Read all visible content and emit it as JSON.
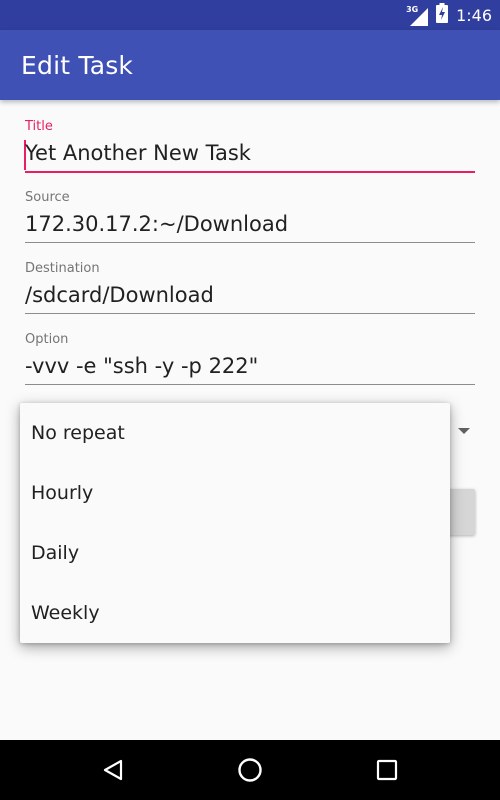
{
  "status_bar": {
    "network_label": "3G",
    "time": "1:46",
    "icons": [
      "signal-icon",
      "battery-charging-icon"
    ]
  },
  "app_bar": {
    "title": "Edit Task"
  },
  "form": {
    "title": {
      "label": "Title",
      "value": "Yet Another New Task"
    },
    "source": {
      "label": "Source",
      "value": "172.30.17.2:~/Download"
    },
    "destination": {
      "label": "Destination",
      "value": "/sdcard/Download"
    },
    "option": {
      "label": "Option",
      "value": "-vvv -e \"ssh -y -p 222\""
    }
  },
  "repeat_dropdown": {
    "options": [
      "No repeat",
      "Hourly",
      "Daily",
      "Weekly"
    ]
  },
  "nav_bar": {
    "icons": [
      "back-icon",
      "home-icon",
      "recents-icon"
    ]
  },
  "colors": {
    "primary": "#3f51b5",
    "primary_dark": "#303f9f",
    "accent": "#e91e63"
  }
}
